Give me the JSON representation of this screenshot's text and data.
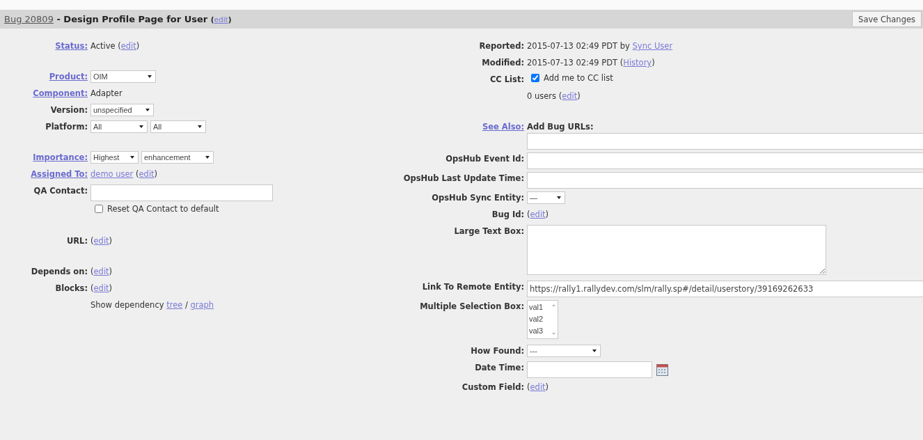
{
  "header": {
    "title_parts": [
      {
        "kind": "link",
        "text": "Bug 20809"
      },
      {
        "kind": "text",
        "text": " - Design Profile Page for User "
      },
      {
        "kind": "small",
        "text": "("
      },
      {
        "kind": "smalllink",
        "text": "edit"
      },
      {
        "kind": "small",
        "text": ")"
      }
    ],
    "save_button": "Save Changes"
  },
  "left_groups": [
    [
      {
        "label": "Status:",
        "label_link": true,
        "kind": "value",
        "parts": [
          {
            "kind": "text",
            "text": "Active ("
          },
          {
            "kind": "link",
            "text": "edit"
          },
          {
            "kind": "text",
            "text": ")"
          }
        ]
      }
    ],
    [
      {
        "label": "Product:",
        "label_link": true,
        "kind": "selects",
        "selects": [
          "OIM"
        ]
      },
      {
        "label": "Component:",
        "label_link": true,
        "kind": "value",
        "parts": [
          {
            "kind": "text",
            "text": "Adapter"
          }
        ]
      },
      {
        "label": "Version:",
        "label_link": false,
        "kind": "selects",
        "selects": [
          "unspecified"
        ]
      },
      {
        "label": "Platform:",
        "label_link": false,
        "kind": "selects",
        "selects": [
          "All",
          "All"
        ]
      }
    ],
    [
      {
        "label": "Importance:",
        "label_link": true,
        "kind": "selects",
        "selects": [
          "Highest",
          "enhancement"
        ]
      },
      {
        "label": "Assigned To:",
        "label_link": true,
        "kind": "value",
        "parts": [
          {
            "kind": "link",
            "text": "demo user"
          },
          {
            "kind": "text",
            "text": " ("
          },
          {
            "kind": "link",
            "text": "edit"
          },
          {
            "kind": "text",
            "text": ")"
          }
        ]
      },
      {
        "label": "QA Contact:",
        "label_link": false,
        "kind": "input"
      },
      {
        "kind": "checkbox",
        "checked": false,
        "text": "Reset QA Contact to default"
      }
    ],
    [
      {
        "label": "URL:",
        "label_link": false,
        "kind": "value",
        "parts": [
          {
            "kind": "text",
            "text": "("
          },
          {
            "kind": "link",
            "text": "edit"
          },
          {
            "kind": "text",
            "text": ")"
          }
        ]
      }
    ],
    [
      {
        "label": "Depends on:",
        "label_link": false,
        "kind": "value",
        "parts": [
          {
            "kind": "text",
            "text": "("
          },
          {
            "kind": "link",
            "text": "edit"
          },
          {
            "kind": "text",
            "text": ")"
          }
        ]
      },
      {
        "label": "Blocks:",
        "label_link": false,
        "kind": "value",
        "parts": [
          {
            "kind": "text",
            "text": "("
          },
          {
            "kind": "link",
            "text": "edit"
          },
          {
            "kind": "text",
            "text": ")"
          }
        ]
      },
      {
        "kind": "value",
        "parts": [
          {
            "kind": "text",
            "text": "Show dependency "
          },
          {
            "kind": "link",
            "text": "tree"
          },
          {
            "kind": "text",
            "text": " / "
          },
          {
            "kind": "link",
            "text": "graph"
          }
        ]
      }
    ]
  ],
  "right_groups": [
    [
      {
        "label": "Reported:",
        "label_link": false,
        "kind": "value",
        "parts": [
          {
            "kind": "text",
            "text": "2015-07-13 02:49 PDT by "
          },
          {
            "kind": "link",
            "text": "Sync User"
          }
        ]
      },
      {
        "label": "Modified:",
        "label_link": false,
        "kind": "value",
        "parts": [
          {
            "kind": "text",
            "text": "2015-07-13 02:49 PDT ("
          },
          {
            "kind": "link",
            "text": "History"
          },
          {
            "kind": "text",
            "text": ")"
          }
        ]
      },
      {
        "label": "CC List:",
        "label_link": false,
        "kind": "checkbox",
        "checked": true,
        "text": "Add me to CC list"
      },
      {
        "kind": "value",
        "parts": [
          {
            "kind": "text",
            "text": "0 users ("
          },
          {
            "kind": "link",
            "text": "edit"
          },
          {
            "kind": "text",
            "text": ")"
          }
        ]
      }
    ],
    [
      {
        "label": "See Also:",
        "label_link": true,
        "kind": "input",
        "heading": "Add Bug URLs:"
      },
      {
        "label": "OpsHub Event Id:",
        "label_link": false,
        "kind": "input"
      },
      {
        "label": "OpsHub Last Update Time:",
        "label_link": false,
        "kind": "input"
      },
      {
        "label": "OpsHub Sync Entity:",
        "label_link": false,
        "kind": "selects",
        "selects": [
          "—"
        ]
      },
      {
        "label": "Bug Id:",
        "label_link": false,
        "kind": "value",
        "parts": [
          {
            "kind": "text",
            "text": "("
          },
          {
            "kind": "link",
            "text": "edit"
          },
          {
            "kind": "text",
            "text": ")"
          }
        ]
      },
      {
        "label": "Large Text Box:",
        "label_link": false,
        "kind": "textarea"
      },
      {
        "label": "Link To Remote Entity:",
        "label_link": false,
        "kind": "input",
        "value": "https://rally1.rallydev.com/slm/rally.sp#/detail/userstory/39169262633"
      },
      {
        "label": "Multiple Selection Box:",
        "label_link": false,
        "kind": "listbox",
        "items": [
          {
            "text": "val1",
            "selected": false
          },
          {
            "text": "val2",
            "selected": false
          },
          {
            "text": "val3",
            "selected": false
          }
        ]
      },
      {
        "label": "How Found:",
        "label_link": false,
        "kind": "selects",
        "selects": [
          "---"
        ]
      },
      {
        "label": "Date Time:",
        "label_link": false,
        "kind": "date"
      },
      {
        "label": "Custom Field:",
        "label_link": false,
        "kind": "value",
        "parts": [
          {
            "kind": "text",
            "text": "("
          },
          {
            "kind": "link",
            "text": "edit"
          },
          {
            "kind": "text",
            "text": ")"
          }
        ]
      }
    ]
  ]
}
